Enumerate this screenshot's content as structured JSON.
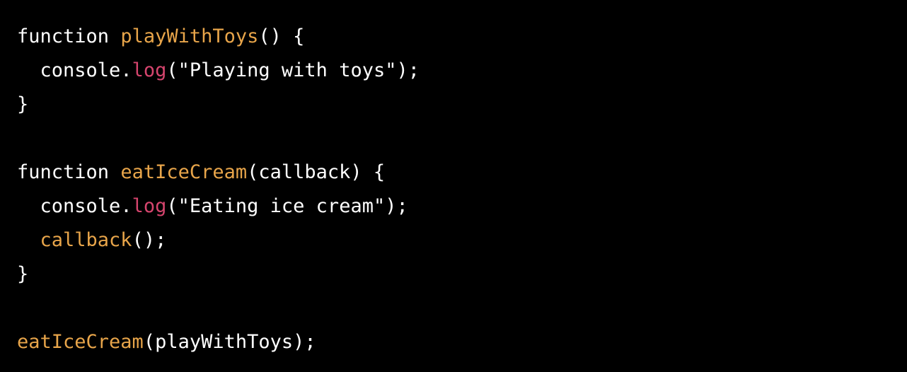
{
  "colors": {
    "background": "#000000",
    "plain": "#ffffff",
    "function_name": "#e8a54a",
    "method": "#d6456e"
  },
  "code": {
    "lines": [
      [
        {
          "text": "function ",
          "kind": "plain"
        },
        {
          "text": "playWithToys",
          "kind": "function_name"
        },
        {
          "text": "() {",
          "kind": "plain"
        }
      ],
      [
        {
          "text": "  console",
          "kind": "plain"
        },
        {
          "text": ".",
          "kind": "plain"
        },
        {
          "text": "log",
          "kind": "method"
        },
        {
          "text": "(\"Playing with toys\");",
          "kind": "plain"
        }
      ],
      [
        {
          "text": "}",
          "kind": "plain"
        }
      ],
      [],
      [
        {
          "text": "function ",
          "kind": "plain"
        },
        {
          "text": "eatIceCream",
          "kind": "function_name"
        },
        {
          "text": "(callback) {",
          "kind": "plain"
        }
      ],
      [
        {
          "text": "  console",
          "kind": "plain"
        },
        {
          "text": ".",
          "kind": "plain"
        },
        {
          "text": "log",
          "kind": "method"
        },
        {
          "text": "(\"Eating ice cream\");",
          "kind": "plain"
        }
      ],
      [
        {
          "text": "  ",
          "kind": "plain"
        },
        {
          "text": "callback",
          "kind": "function_name"
        },
        {
          "text": "();",
          "kind": "plain"
        }
      ],
      [
        {
          "text": "}",
          "kind": "plain"
        }
      ],
      [],
      [
        {
          "text": "eatIceCream",
          "kind": "function_name"
        },
        {
          "text": "(playWithToys);",
          "kind": "plain"
        }
      ]
    ]
  }
}
